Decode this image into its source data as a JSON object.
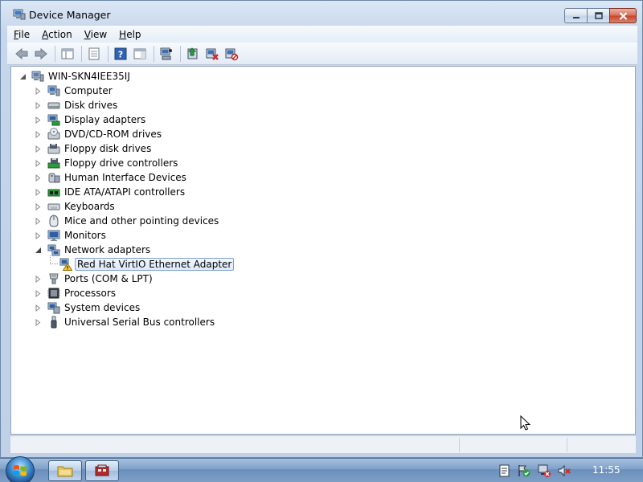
{
  "window": {
    "title": "Device Manager"
  },
  "menu": [
    {
      "label": "File",
      "mnemonic": "F",
      "rest": "ile"
    },
    {
      "label": "Action",
      "mnemonic": "A",
      "rest": "ction"
    },
    {
      "label": "View",
      "mnemonic": "V",
      "rest": "iew"
    },
    {
      "label": "Help",
      "mnemonic": "H",
      "rest": "elp"
    }
  ],
  "toolbar": {
    "buttons": [
      "back-icon",
      "forward-icon",
      "console-tree-icon",
      "properties-icon",
      "help-icon",
      "show-hide-icon",
      "scan-hardware-icon",
      "update-driver-icon",
      "disable-device-icon",
      "uninstall-device-icon"
    ]
  },
  "tree": {
    "root": "WIN-SKN4IEE35IJ",
    "categories": [
      {
        "label": "Computer",
        "icon": "computer-icon",
        "expanded": false
      },
      {
        "label": "Disk drives",
        "icon": "disk-drive-icon",
        "expanded": false
      },
      {
        "label": "Display adapters",
        "icon": "display-adapter-icon",
        "expanded": false
      },
      {
        "label": "DVD/CD-ROM drives",
        "icon": "dvd-drive-icon",
        "expanded": false
      },
      {
        "label": "Floppy disk drives",
        "icon": "floppy-drive-icon",
        "expanded": false
      },
      {
        "label": "Floppy drive controllers",
        "icon": "floppy-controller-icon",
        "expanded": false
      },
      {
        "label": "Human Interface Devices",
        "icon": "hid-icon",
        "expanded": false
      },
      {
        "label": "IDE ATA/ATAPI controllers",
        "icon": "ide-controller-icon",
        "expanded": false
      },
      {
        "label": "Keyboards",
        "icon": "keyboard-icon",
        "expanded": false
      },
      {
        "label": "Mice and other pointing devices",
        "icon": "mouse-icon",
        "expanded": false
      },
      {
        "label": "Monitors",
        "icon": "monitor-icon",
        "expanded": false
      },
      {
        "label": "Network adapters",
        "icon": "network-adapter-icon",
        "expanded": true
      },
      {
        "label": "Red Hat VirtIO Ethernet Adapter",
        "icon": "network-warning-icon",
        "child": true,
        "selected": true
      },
      {
        "label": "Ports (COM & LPT)",
        "icon": "port-icon",
        "expanded": false
      },
      {
        "label": "Processors",
        "icon": "processor-icon",
        "expanded": false
      },
      {
        "label": "System devices",
        "icon": "system-device-icon",
        "expanded": false
      },
      {
        "label": "Universal Serial Bus controllers",
        "icon": "usb-icon",
        "expanded": false
      }
    ]
  },
  "taskbar": {
    "clock": "11:55",
    "colors": {
      "start": "#3c88cc",
      "close": "#c8432a"
    }
  }
}
